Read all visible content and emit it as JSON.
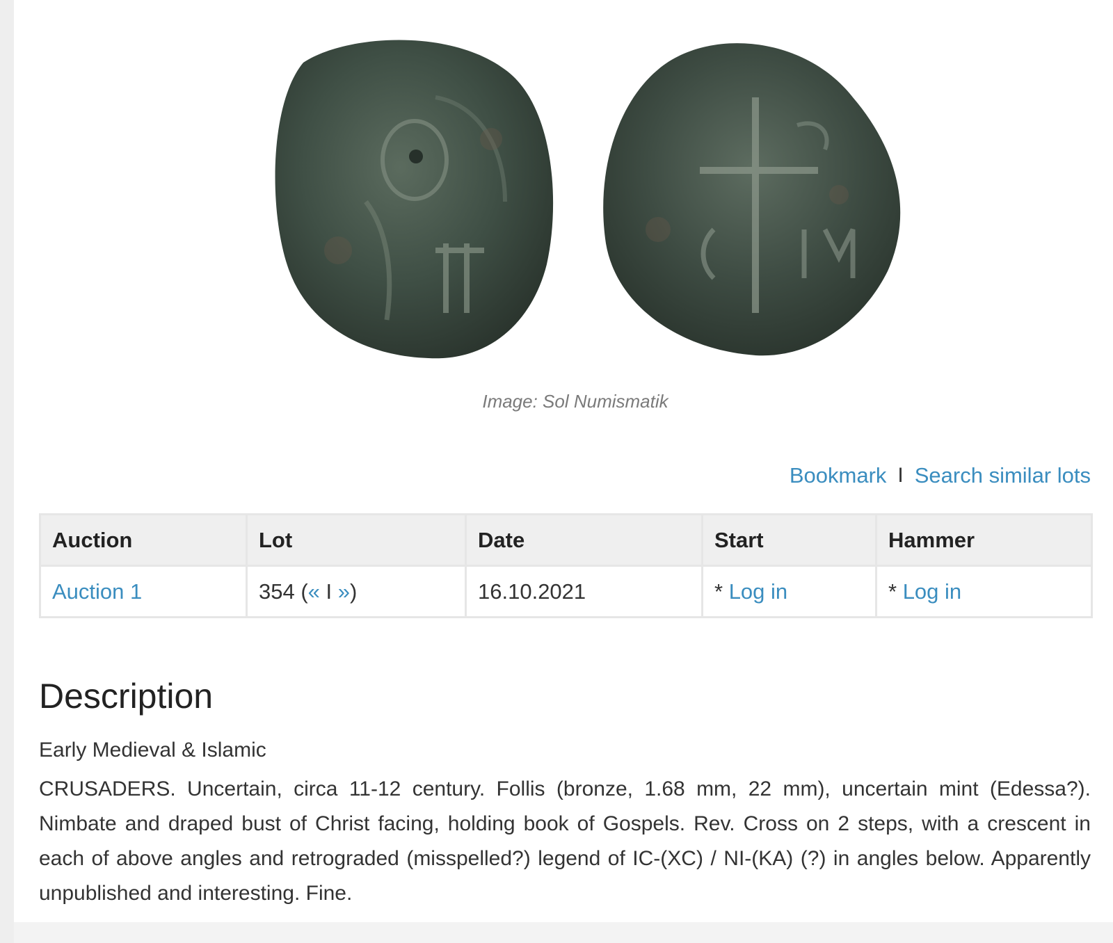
{
  "image": {
    "caption": "Image: Sol Numismatik",
    "obverse_icon": "coin-obverse-bust-icon",
    "reverse_icon": "coin-reverse-cross-icon"
  },
  "actions": {
    "bookmark_label": "Bookmark",
    "separator": "I",
    "search_similar_label": "Search similar lots"
  },
  "table": {
    "headers": {
      "auction": "Auction",
      "lot": "Lot",
      "date": "Date",
      "start": "Start",
      "hammer": "Hammer"
    },
    "row": {
      "auction_link": "Auction 1",
      "lot_number": "354",
      "lot_open": " (",
      "prev_label": "«",
      "nav_separator": " I ",
      "next_label": "»",
      "lot_close": ")",
      "date": "16.10.2021",
      "start_prefix": "* ",
      "start_link": "Log in",
      "hammer_prefix": "* ",
      "hammer_link": "Log in"
    }
  },
  "description": {
    "title": "Description",
    "category": "Early Medieval & Islamic",
    "text": "CRUSADERS. Uncertain, circa 11-12 century. Follis (bronze, 1.68 mm, 22 mm), uncertain mint (Edessa?). Nimbate and draped bust of Christ facing, holding book of Gospels. Rev. Cross on 2 steps, with a crescent in each of above angles and retrograded (misspelled?) legend of IC-(XC) / NI-(KA) (?) in angles below. Apparently unpublished and interesting. Fine."
  },
  "colors": {
    "link": "#3a8dbf",
    "header_bg": "#efefef",
    "border": "#e6e6e6",
    "coin_base": "#3f4f45"
  }
}
